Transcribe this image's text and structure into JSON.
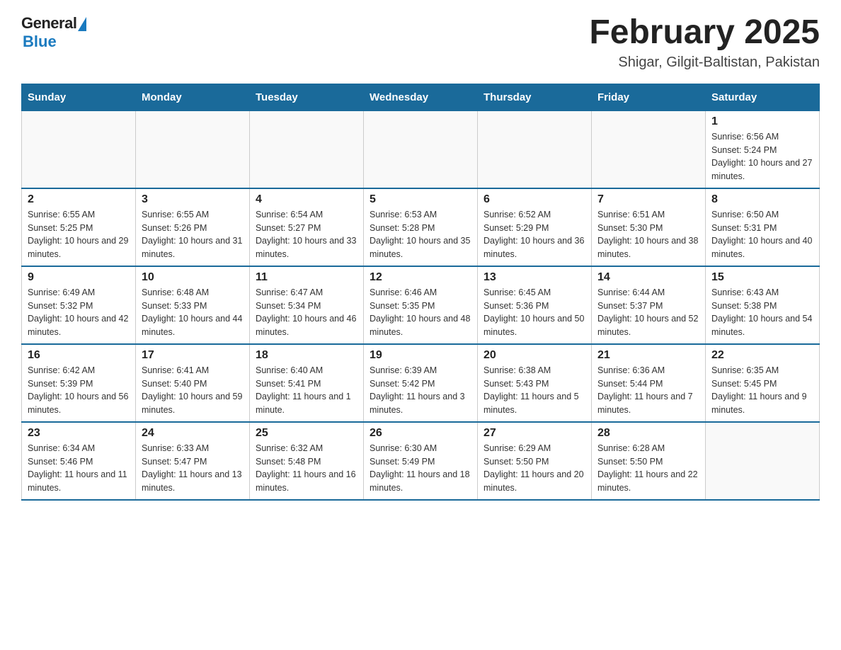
{
  "logo": {
    "general": "General",
    "blue": "Blue"
  },
  "title": "February 2025",
  "location": "Shigar, Gilgit-Baltistan, Pakistan",
  "days_of_week": [
    "Sunday",
    "Monday",
    "Tuesday",
    "Wednesday",
    "Thursday",
    "Friday",
    "Saturday"
  ],
  "weeks": [
    [
      {
        "day": "",
        "info": ""
      },
      {
        "day": "",
        "info": ""
      },
      {
        "day": "",
        "info": ""
      },
      {
        "day": "",
        "info": ""
      },
      {
        "day": "",
        "info": ""
      },
      {
        "day": "",
        "info": ""
      },
      {
        "day": "1",
        "info": "Sunrise: 6:56 AM\nSunset: 5:24 PM\nDaylight: 10 hours and 27 minutes."
      }
    ],
    [
      {
        "day": "2",
        "info": "Sunrise: 6:55 AM\nSunset: 5:25 PM\nDaylight: 10 hours and 29 minutes."
      },
      {
        "day": "3",
        "info": "Sunrise: 6:55 AM\nSunset: 5:26 PM\nDaylight: 10 hours and 31 minutes."
      },
      {
        "day": "4",
        "info": "Sunrise: 6:54 AM\nSunset: 5:27 PM\nDaylight: 10 hours and 33 minutes."
      },
      {
        "day": "5",
        "info": "Sunrise: 6:53 AM\nSunset: 5:28 PM\nDaylight: 10 hours and 35 minutes."
      },
      {
        "day": "6",
        "info": "Sunrise: 6:52 AM\nSunset: 5:29 PM\nDaylight: 10 hours and 36 minutes."
      },
      {
        "day": "7",
        "info": "Sunrise: 6:51 AM\nSunset: 5:30 PM\nDaylight: 10 hours and 38 minutes."
      },
      {
        "day": "8",
        "info": "Sunrise: 6:50 AM\nSunset: 5:31 PM\nDaylight: 10 hours and 40 minutes."
      }
    ],
    [
      {
        "day": "9",
        "info": "Sunrise: 6:49 AM\nSunset: 5:32 PM\nDaylight: 10 hours and 42 minutes."
      },
      {
        "day": "10",
        "info": "Sunrise: 6:48 AM\nSunset: 5:33 PM\nDaylight: 10 hours and 44 minutes."
      },
      {
        "day": "11",
        "info": "Sunrise: 6:47 AM\nSunset: 5:34 PM\nDaylight: 10 hours and 46 minutes."
      },
      {
        "day": "12",
        "info": "Sunrise: 6:46 AM\nSunset: 5:35 PM\nDaylight: 10 hours and 48 minutes."
      },
      {
        "day": "13",
        "info": "Sunrise: 6:45 AM\nSunset: 5:36 PM\nDaylight: 10 hours and 50 minutes."
      },
      {
        "day": "14",
        "info": "Sunrise: 6:44 AM\nSunset: 5:37 PM\nDaylight: 10 hours and 52 minutes."
      },
      {
        "day": "15",
        "info": "Sunrise: 6:43 AM\nSunset: 5:38 PM\nDaylight: 10 hours and 54 minutes."
      }
    ],
    [
      {
        "day": "16",
        "info": "Sunrise: 6:42 AM\nSunset: 5:39 PM\nDaylight: 10 hours and 56 minutes."
      },
      {
        "day": "17",
        "info": "Sunrise: 6:41 AM\nSunset: 5:40 PM\nDaylight: 10 hours and 59 minutes."
      },
      {
        "day": "18",
        "info": "Sunrise: 6:40 AM\nSunset: 5:41 PM\nDaylight: 11 hours and 1 minute."
      },
      {
        "day": "19",
        "info": "Sunrise: 6:39 AM\nSunset: 5:42 PM\nDaylight: 11 hours and 3 minutes."
      },
      {
        "day": "20",
        "info": "Sunrise: 6:38 AM\nSunset: 5:43 PM\nDaylight: 11 hours and 5 minutes."
      },
      {
        "day": "21",
        "info": "Sunrise: 6:36 AM\nSunset: 5:44 PM\nDaylight: 11 hours and 7 minutes."
      },
      {
        "day": "22",
        "info": "Sunrise: 6:35 AM\nSunset: 5:45 PM\nDaylight: 11 hours and 9 minutes."
      }
    ],
    [
      {
        "day": "23",
        "info": "Sunrise: 6:34 AM\nSunset: 5:46 PM\nDaylight: 11 hours and 11 minutes."
      },
      {
        "day": "24",
        "info": "Sunrise: 6:33 AM\nSunset: 5:47 PM\nDaylight: 11 hours and 13 minutes."
      },
      {
        "day": "25",
        "info": "Sunrise: 6:32 AM\nSunset: 5:48 PM\nDaylight: 11 hours and 16 minutes."
      },
      {
        "day": "26",
        "info": "Sunrise: 6:30 AM\nSunset: 5:49 PM\nDaylight: 11 hours and 18 minutes."
      },
      {
        "day": "27",
        "info": "Sunrise: 6:29 AM\nSunset: 5:50 PM\nDaylight: 11 hours and 20 minutes."
      },
      {
        "day": "28",
        "info": "Sunrise: 6:28 AM\nSunset: 5:50 PM\nDaylight: 11 hours and 22 minutes."
      },
      {
        "day": "",
        "info": ""
      }
    ]
  ]
}
